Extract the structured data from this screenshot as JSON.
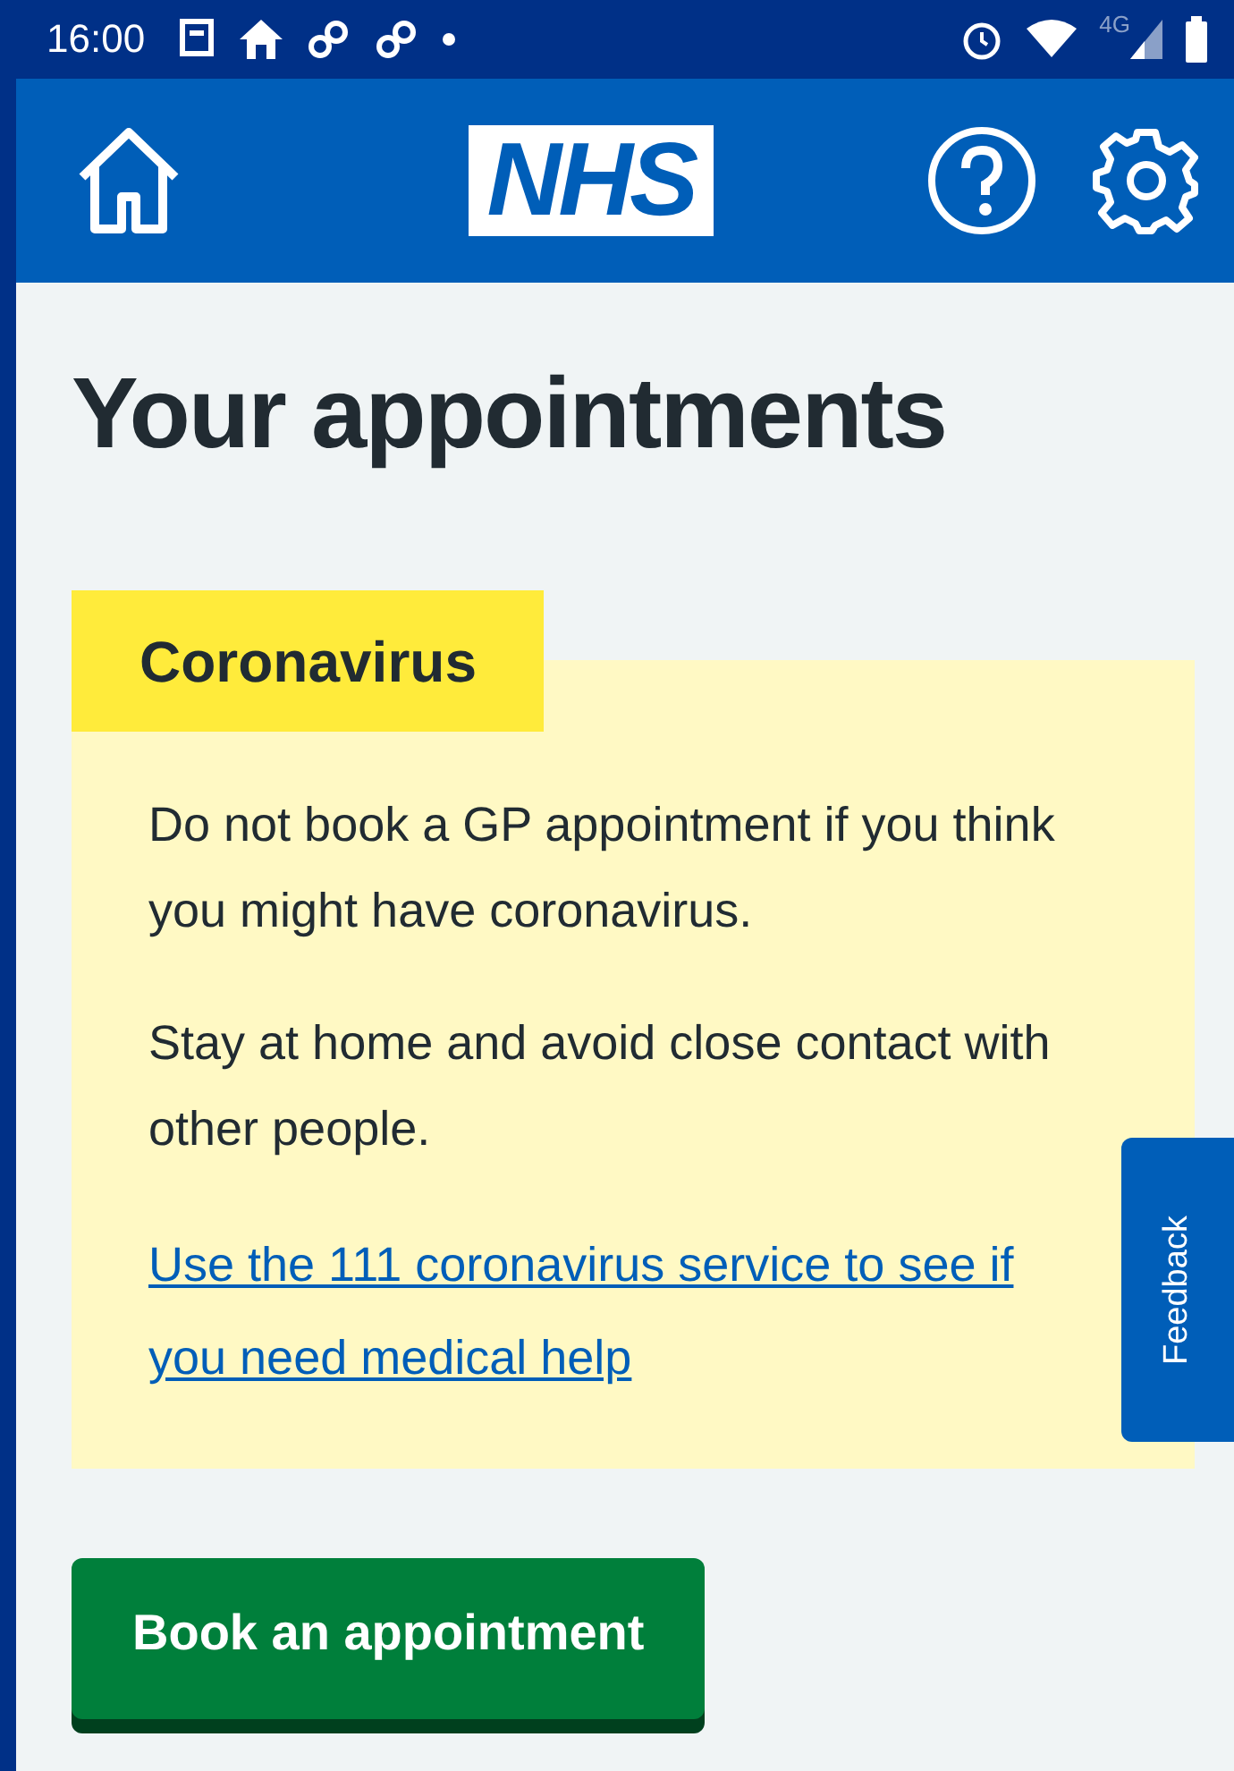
{
  "status_bar": {
    "time": "16:00",
    "network": "4G"
  },
  "header": {
    "logo": "NHS"
  },
  "page": {
    "title": "Your appointments"
  },
  "callout": {
    "label": "Coronavirus",
    "paragraphs": [
      "Do not book a GP appointment if you think you might have coronavirus.",
      "Stay at home and avoid close contact with other people."
    ],
    "link": "Use the 111 coronavirus service to see if you need medical help"
  },
  "feedback": {
    "label": "Feedback"
  },
  "buttons": [
    "Book an appointment"
  ]
}
